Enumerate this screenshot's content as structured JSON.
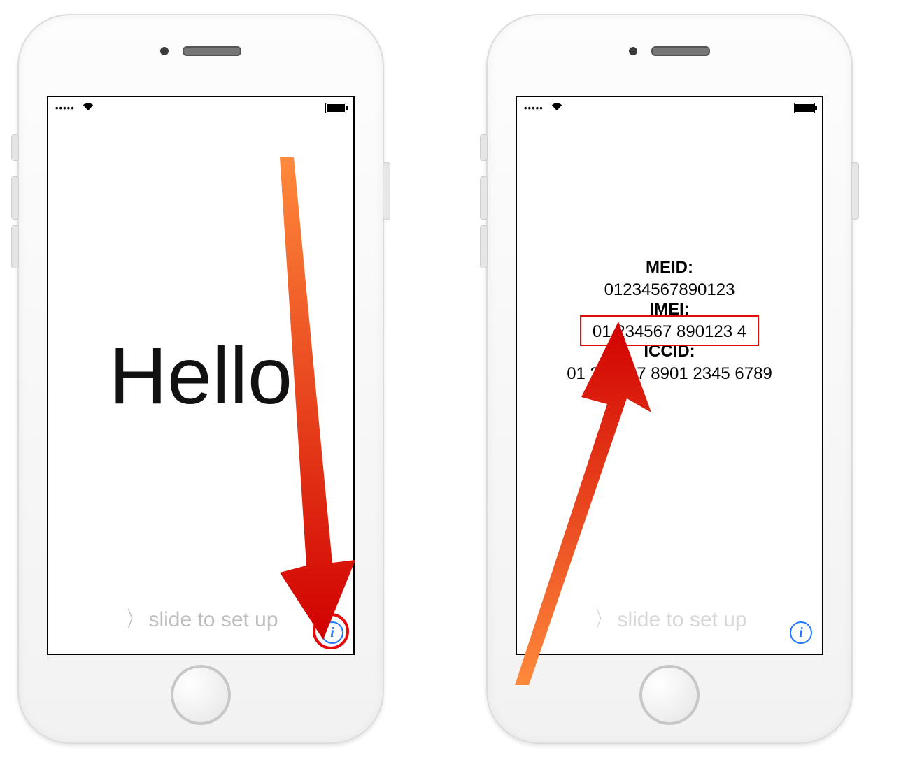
{
  "statusbar": {
    "signal": "•••••",
    "wifi_glyph": "▲"
  },
  "left": {
    "hello": "Hello",
    "slide": "slide to set up",
    "info_glyph": "i"
  },
  "right": {
    "meid_label": "MEID:",
    "meid_value": "01234567890123",
    "imei_label": "IMEI:",
    "imei_value": "01 234567 890123 4",
    "iccid_label": "ICCID:",
    "iccid_value": "01 234567 8901 2345 6789",
    "slide": "slide to set up",
    "info_glyph": "i"
  },
  "annotation_color": "#e6090a"
}
